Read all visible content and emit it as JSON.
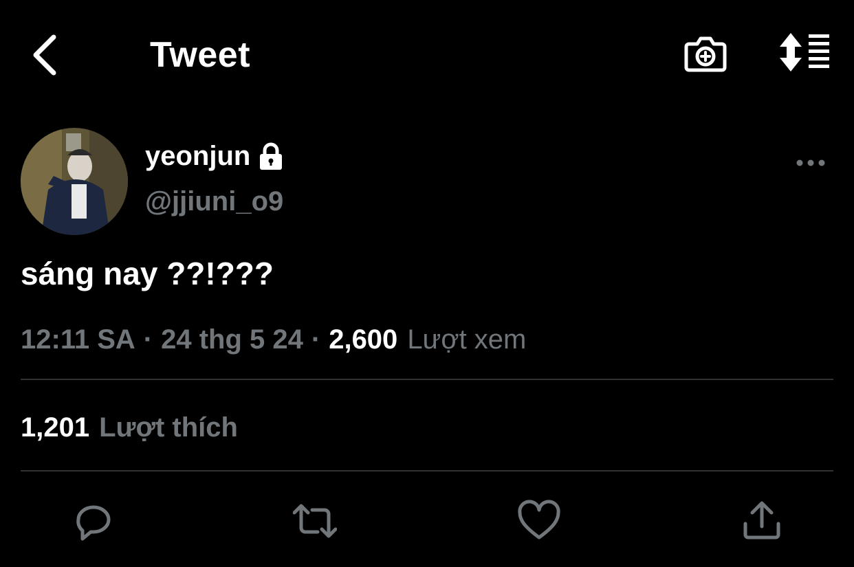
{
  "header": {
    "title": "Tweet",
    "back_icon": "chevron-left-icon",
    "camera_icon": "camera-plus-icon",
    "sort_icon": "sort-list-icon"
  },
  "author": {
    "display_name": "yeonjun",
    "handle": "@jjiuni_o9",
    "protected_icon": "lock-icon"
  },
  "tweet": {
    "text": "sáng nay ??!???"
  },
  "meta": {
    "time": "12:11 SA",
    "date": "24 thg 5 24",
    "views_count": "2,600",
    "views_label": "Lượt xem"
  },
  "stats": {
    "likes_count": "1,201",
    "likes_label": "Lượt thích"
  },
  "actions": [
    "reply-icon",
    "retweet-icon",
    "like-icon",
    "share-icon"
  ],
  "colors": {
    "background": "#000000",
    "text_primary": "#ffffff",
    "text_muted": "#71767b",
    "divider": "#2f3336"
  }
}
